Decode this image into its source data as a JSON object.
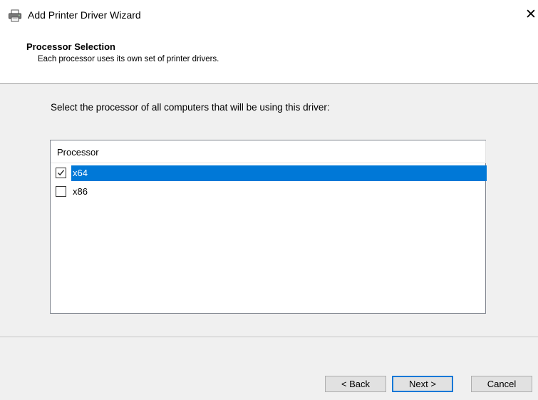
{
  "window": {
    "title": "Add Printer Driver Wizard",
    "title_icon": "printer-icon",
    "close_glyph": "✕"
  },
  "header": {
    "title": "Processor Selection",
    "subtitle": "Each processor uses its own set of printer drivers."
  },
  "main": {
    "instruction": "Select the processor of all computers that will be using this driver:",
    "list": {
      "column_header": "Processor",
      "items": [
        {
          "label": "x64",
          "checked": true,
          "selected": true
        },
        {
          "label": "x86",
          "checked": false,
          "selected": false
        }
      ]
    }
  },
  "footer": {
    "back_label": "< Back",
    "next_label": "Next >",
    "cancel_label": "Cancel"
  },
  "colors": {
    "selection": "#0078d7",
    "panel_background": "#f0f0f0",
    "button_face": "#e1e1e1"
  }
}
